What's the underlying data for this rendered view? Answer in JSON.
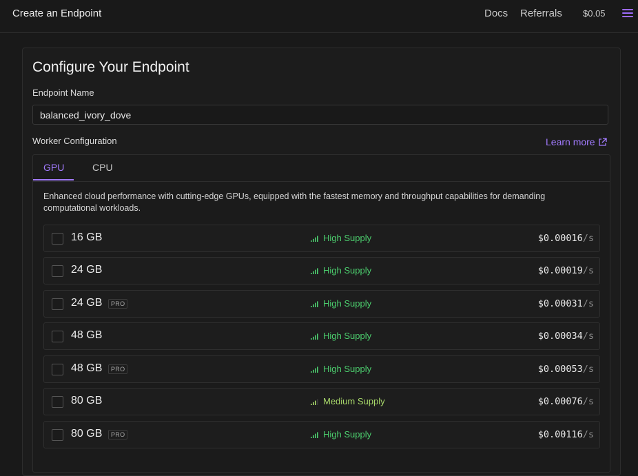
{
  "header": {
    "title": "Create an Endpoint",
    "nav": [
      "Docs",
      "Referrals"
    ],
    "credit": "$0.05",
    "accent_color": "#a27bff"
  },
  "form": {
    "heading": "Configure Your Endpoint",
    "endpoint_name_label": "Endpoint Name",
    "endpoint_name_value": "balanced_ivory_dove",
    "worker_config_label": "Worker Configuration",
    "learn_more": "Learn more"
  },
  "tabs": [
    {
      "label": "GPU",
      "active": true
    },
    {
      "label": "CPU",
      "active": false
    }
  ],
  "gpu_description": "Enhanced cloud performance with cutting-edge GPUs, equipped with the fastest memory and throughput capabilities for demanding computational workloads.",
  "gpus": [
    {
      "memory": "16 GB",
      "pro": "",
      "supply": "High Supply",
      "supply_level": "high",
      "price": "$0.00016",
      "unit": "/s",
      "checked": false
    },
    {
      "memory": "24 GB",
      "pro": "",
      "supply": "High Supply",
      "supply_level": "high",
      "price": "$0.00019",
      "unit": "/s",
      "checked": false
    },
    {
      "memory": "24 GB",
      "pro": "PRO",
      "supply": "High Supply",
      "supply_level": "high",
      "price": "$0.00031",
      "unit": "/s",
      "checked": false
    },
    {
      "memory": "48 GB",
      "pro": "",
      "supply": "High Supply",
      "supply_level": "high",
      "price": "$0.00034",
      "unit": "/s",
      "checked": false
    },
    {
      "memory": "48 GB",
      "pro": "PRO",
      "supply": "High Supply",
      "supply_level": "high",
      "price": "$0.00053",
      "unit": "/s",
      "checked": false
    },
    {
      "memory": "80 GB",
      "pro": "",
      "supply": "Medium Supply",
      "supply_level": "medium",
      "price": "$0.00076",
      "unit": "/s",
      "checked": false
    },
    {
      "memory": "80 GB",
      "pro": "PRO",
      "supply": "High Supply",
      "supply_level": "high",
      "price": "$0.00116",
      "unit": "/s",
      "checked": false
    }
  ]
}
